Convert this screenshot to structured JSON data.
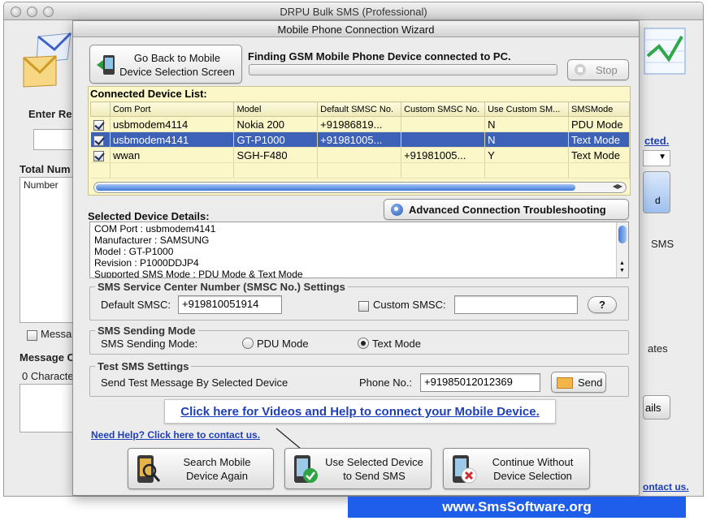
{
  "main_window": {
    "title": "DRPU Bulk SMS (Professional)",
    "enter_recipient_label": "Enter Rec",
    "total_numbers_label": "Total Num",
    "number_column": "Number",
    "message_checkbox_label": "Messa",
    "message_composer_label": "Message C",
    "characters_label": "0 Characte",
    "right_link": "cted.",
    "sms_label": "SMS",
    "button_fragment": "d",
    "rates_fragment": "ates",
    "details_button": "ails",
    "contact_link": "ontact us."
  },
  "wizard": {
    "title": "Mobile Phone Connection Wizard",
    "go_back_button": "Go Back to Mobile\nDevice Selection Screen",
    "finding_text": "Finding GSM Mobile Phone Device connected to PC.",
    "stop_button": "Stop",
    "device_list": {
      "title": "Connected Device List:",
      "columns": [
        "Com Port",
        "Model",
        "Default SMSC No.",
        "Custom SMSC No.",
        "Use Custom SM...",
        "SMSMode"
      ],
      "rows": [
        {
          "checked": true,
          "com_port": "usbmodem4114",
          "model": "Nokia 200",
          "default_smsc": "+91986819...",
          "custom_smsc": "",
          "use_custom": "N",
          "sms_mode": "PDU Mode",
          "selected": false
        },
        {
          "checked": true,
          "com_port": "usbmodem4141",
          "model": "GT-P1000",
          "default_smsc": "+91981005...",
          "custom_smsc": "",
          "use_custom": "N",
          "sms_mode": "Text Mode",
          "selected": true
        },
        {
          "checked": true,
          "com_port": "wwan",
          "model": "SGH-F480",
          "default_smsc": "",
          "custom_smsc": "+91981005...",
          "use_custom": "Y",
          "sms_mode": "Text Mode",
          "selected": false
        }
      ]
    },
    "advanced_button": "Advanced Connection Troubleshooting",
    "selected_details": {
      "label": "Selected Device Details:",
      "lines": [
        "COM Port : usbmodem4141",
        "Manufacturer : SAMSUNG",
        "Model : GT-P1000",
        "Revision : P1000DDJP4",
        "Supported SMS Mode : PDU Mode & Text Mode"
      ]
    },
    "smsc_settings": {
      "title": "SMS Service Center Number (SMSC No.) Settings",
      "default_label": "Default SMSC:",
      "default_value": "+919810051914",
      "custom_label": "Custom SMSC:",
      "custom_value": "",
      "help_button": "?"
    },
    "sending_mode": {
      "title": "SMS Sending Mode",
      "label": "SMS Sending Mode:",
      "pdu_label": "PDU Mode",
      "text_label": "Text Mode",
      "selected": "Text Mode"
    },
    "test_sms": {
      "title": "Test SMS Settings",
      "description": "Send Test Message By Selected Device",
      "phone_label": "Phone No.:",
      "phone_value": "+91985012012369",
      "send_button": "Send"
    },
    "help_link": "Click here for Videos and Help to connect your Mobile Device.",
    "need_help_link": "Need Help? Click here to contact us.",
    "buttons": {
      "search": "Search Mobile\nDevice Again",
      "use_selected": "Use Selected Device\nto Send SMS",
      "continue_without": "Continue Without\nDevice Selection"
    }
  },
  "footer_url": "www.SmsSoftware.org"
}
